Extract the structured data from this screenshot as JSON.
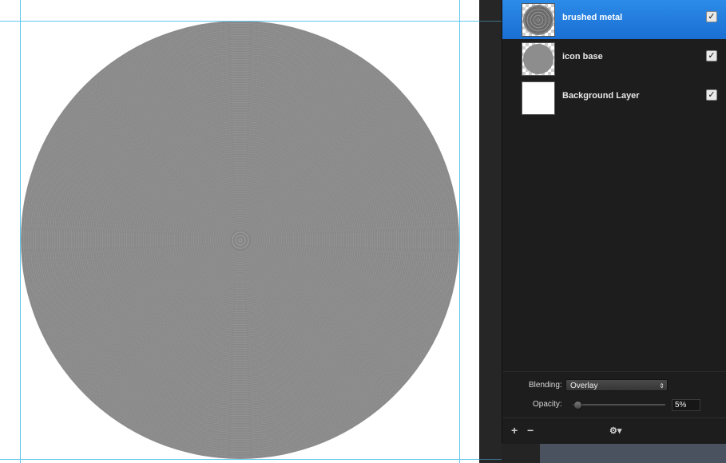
{
  "layers": [
    {
      "name": "brushed metal",
      "visible_mark": "✓",
      "selected": true,
      "thumb": "brushed-circle"
    },
    {
      "name": "icon base",
      "visible_mark": "✓",
      "selected": false,
      "thumb": "gray-circle"
    },
    {
      "name": "Background Layer",
      "visible_mark": "✓",
      "selected": false,
      "thumb": "white"
    }
  ],
  "properties": {
    "blending_label": "Blending:",
    "blending_value": "Overlay",
    "blending_arrow": "⌃⌄",
    "opacity_label": "Opacity:",
    "opacity_value": "5%",
    "opacity_fraction": 0.05
  },
  "footer": {
    "add_label": "+",
    "remove_label": "−",
    "gear_label": "⚙▾"
  },
  "colors": {
    "selection": "#1a6fd3",
    "guide": "#62c8f0",
    "panel_bg": "#1d1d1d"
  }
}
